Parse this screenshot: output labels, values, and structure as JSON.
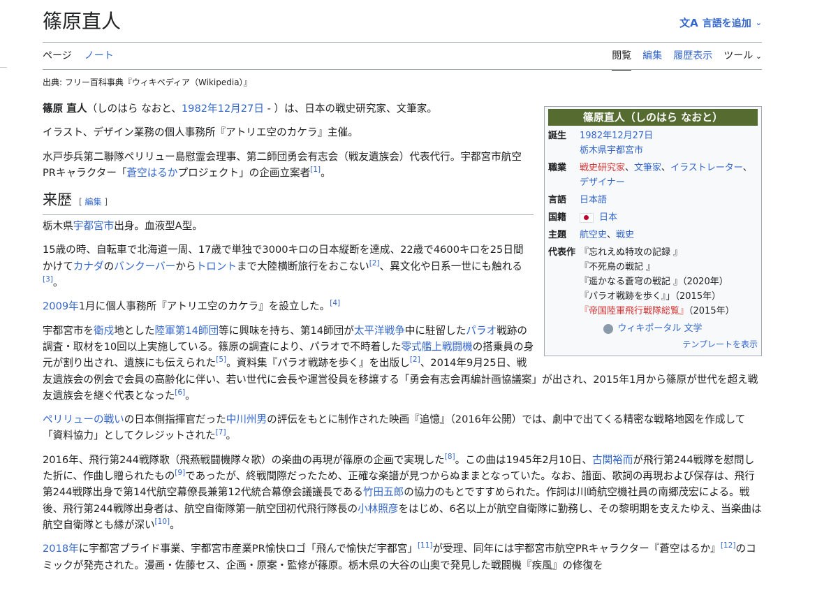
{
  "page_title": "篠原直人",
  "language_button": {
    "icon": "translate-icon",
    "label": "言語を追加",
    "chevron": "chevron-down-icon"
  },
  "tabs_left": [
    "ページ",
    "ノート"
  ],
  "tabs_right": [
    "閲覧",
    "編集",
    "履歴表示",
    "ツール"
  ],
  "from_line": "出典: フリー百科事典『ウィキペディア（Wikipedia）』",
  "intro": {
    "name_bold": "篠原 直人",
    "reading_pre": "（しのはら なおと、",
    "birth_link": "1982年12月27日",
    "reading_post": " - ）は、日本の戦史研究家、文筆家。",
    "p2": "イラスト、デザイン業務の個人事務所『アトリエ空のカケラ』主催。",
    "p3_a": "水戸歩兵第二聯隊ペリリュー島慰霊会理事、第二師団勇会有志会（戦友遺族会）代表代行。宇都宮市航空PRキャラクター「",
    "p3_link": "蒼空はるか",
    "p3_b": "プロジェクト」の企画立案者",
    "p3_ref": "[1]",
    "p3_end": "。"
  },
  "infobox": {
    "title": "篠原直人（しのはら なおと）",
    "birth_key": "誕生",
    "birth_date": "1982年12月27日",
    "birth_place": "栃木県宇都宮市",
    "job_key": "職業",
    "job_1": "戦史研究家",
    "job_sep1": "、",
    "job_2": "文筆家",
    "job_sep2": "、",
    "job_3": "イラストレーター",
    "job_sep3": "、",
    "job_4": "デザイナー",
    "lang_key": "言語",
    "lang_val": "日本語",
    "nat_key": "国籍",
    "nat_val": "日本",
    "theme_key": "主題",
    "theme_1": "航空史",
    "theme_sep": "、",
    "theme_2": "戦史",
    "works_key": "代表作",
    "work_1": "『忘れえぬ特攻の記録 』",
    "work_2": "『不死鳥の戦記 』",
    "work_3": "『遥かなる蒼穹の戦記 』（2020年）",
    "work_4": "『パラオ戦跡を歩く』」（2015年）",
    "work_5_link": "『帝国陸軍飛行戦隊総覧』",
    "work_5_year": "（2015年）",
    "portal": "ウィキポータル 文学",
    "template": "テンプレートを表示"
  },
  "section": {
    "heading": "来歴",
    "edit_open": "[ ",
    "edit": "編集",
    "edit_close": " ]"
  },
  "body": {
    "p1_a": "栃木県",
    "p1_link": "宇都宮市",
    "p1_b": "出身。血液型A型。",
    "p2_a": "15歳の時、自転車で北海道一周、17歳で単独で3000キロの日本縦断を達成、22歳で4600キロを25日間かけて",
    "p2_l1": "カナダ",
    "p2_b": "の",
    "p2_l2": "バンクーバー",
    "p2_c": "から",
    "p2_l3": "トロント",
    "p2_d": "まで大陸横断旅行をおこない",
    "p2_r1": "[2]",
    "p2_e": "、異文化や日系一世にも触れる",
    "p2_r2": "[3]",
    "p2_f": "。",
    "p3_link": "2009年",
    "p3_a": "1月に個人事務所『アトリエ空のカケラ』を設立した。",
    "p3_ref": "[4]",
    "p4_a": "宇都宮市を",
    "p4_l1": "衛戍",
    "p4_b": "地とした",
    "p4_l2": "陸軍第14師団",
    "p4_c": "等に興味を持ち、第14師団が",
    "p4_l3": "太平洋戦争",
    "p4_d": "中に駐留した",
    "p4_l4": "パラオ",
    "p4_e": "戦跡の調査・取材を10回以上実施している。篠原の調査により、パラオで不時着した",
    "p4_l5": "零式艦上戦闘機",
    "p4_f": "の搭乗員の身元が割り出され、遺族にも伝えられた",
    "p4_r1": "[5]",
    "p4_g": "。資料集『パラオ戦跡を歩く』を出版し",
    "p4_r2": "[2]",
    "p4_h": "、2014年9月25日、戦友遺族会の例会で会員の高齢化に伴い、若い世代に会長や運営役員を移譲する「勇会有志会再編計画協議案」が出され、2015年1月から篠原が世代を超え戦友遺族会を継ぐ代表となった",
    "p4_r3": "[6]",
    "p4_i": "。",
    "p5_l1": "ペリリューの戦い",
    "p5_a": "の日本側指揮官だった",
    "p5_l2": "中川州男",
    "p5_b": "の評伝をもとに制作された映画『追憶』（2016年公開）では、劇中で出てくる精密な戦略地図を作成して「資料協力」としてクレジットされた",
    "p5_r": "[7]",
    "p5_c": "。",
    "p6_a": "2016年、飛行第244戦隊歌（飛燕戦闘機隊々歌）の楽曲の再現が篠原の企画で実現した",
    "p6_r1": "[8]",
    "p6_b": "。この曲は1945年2月10日、",
    "p6_l1": "古関裕而",
    "p6_c": "が飛行第244戦隊を慰問した折に、作曲し贈られたもの",
    "p6_r2": "[9]",
    "p6_d": "であったが、終戦間際だったため、正確な楽譜が見つからぬままとなっていた。なお、譜面、歌詞の再現および保存は、飛行第244戦隊出身で第14代航空幕僚長兼第12代統合幕僚会議議長である",
    "p6_l2": "竹田五郎",
    "p6_e": "の協力のもとですすめられた。作詞は川崎航空機社員の南郷茂宏による。戦後、飛行第244戦隊出身者は、航空自衛隊第一航空団初代飛行隊長の",
    "p6_l3": "小林照彦",
    "p6_f": "をはじめ、6名以上が航空自衛隊に勤務し、その黎明期を支えたゆえ、当楽曲は航空自衛隊とも縁が深い",
    "p6_r3": "[10]",
    "p6_g": "。",
    "p7_link": "2018年",
    "p7_a": "に宇都宮プライド事業、宇都宮市産業PR愉快ロゴ「飛んで愉快だ宇都宮」",
    "p7_r1": "[11]",
    "p7_b": "が受理、同年には宇都宮市航空PRキャラクター『蒼空はるか』",
    "p7_r2": "[12]",
    "p7_c": "のコミックが発売された。漫画・佐藤セス、企画・原案・監修が篠原。栃木県の大谷の山奥で発見した戦闘機『疾風』の修復を"
  }
}
